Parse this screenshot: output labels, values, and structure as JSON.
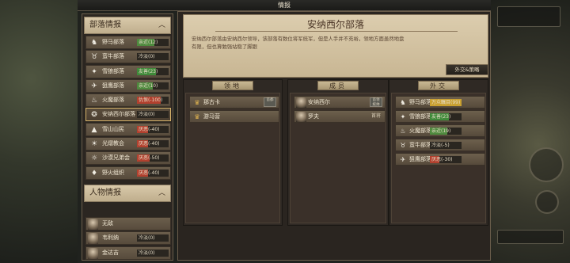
{
  "topbar": {
    "title": "情报"
  },
  "left": {
    "tribes_header": "部落情报",
    "tribes": [
      {
        "name": "野马部落",
        "relation": "亲近(12)",
        "color": "#4e8a3e",
        "fill": 0.55,
        "icon": "horse-icon",
        "glyph": "♞"
      },
      {
        "name": "蛮牛部落",
        "relation": "冷淡(0)",
        "color": "#2a2620",
        "fill": 0,
        "icon": "bull-icon",
        "glyph": "♉"
      },
      {
        "name": "雪狼部落",
        "relation": "友善(23)",
        "color": "#3f8a3a",
        "fill": 0.6,
        "icon": "wolf-icon",
        "glyph": "✦"
      },
      {
        "name": "狙鹰部落",
        "relation": "亲近(10)",
        "color": "#4e8a3e",
        "fill": 0.5,
        "icon": "eagle-icon",
        "glyph": "✈"
      },
      {
        "name": "火魔部落",
        "relation": "仇恨(-100)",
        "color": "#b2402e",
        "fill": 0.75,
        "icon": "fire-demon-icon",
        "glyph": "♨"
      },
      {
        "name": "安纳西尔部落",
        "relation": "冷淡(0)",
        "color": "#2a2620",
        "fill": 0,
        "icon": "flame-crest-icon",
        "glyph": "❂"
      },
      {
        "name": "雪山山民",
        "relation": "厌恶(-40)",
        "color": "#b2402e",
        "fill": 0.35,
        "icon": "mountain-icon",
        "glyph": "▲"
      },
      {
        "name": "光熠教会",
        "relation": "厌恶(-40)",
        "color": "#b2402e",
        "fill": 0.35,
        "icon": "sun-icon",
        "glyph": "☀"
      },
      {
        "name": "沙漠兄弟会",
        "relation": "厌恶(-50)",
        "color": "#b2402e",
        "fill": 0.4,
        "icon": "desert-icon",
        "glyph": "☼"
      },
      {
        "name": "野火组织",
        "relation": "厌恶(-40)",
        "color": "#b2402e",
        "fill": 0.35,
        "icon": "wildfire-icon",
        "glyph": "♦"
      }
    ],
    "chars_header": "人物情报",
    "chars": [
      {
        "name": "无敌",
        "relation": ""
      },
      {
        "name": "韦利纳",
        "relation": "冷淡(0)"
      },
      {
        "name": "金达吉",
        "relation": "冷淡(0)"
      }
    ]
  },
  "main": {
    "title": "安纳西尔部落",
    "description": "安纳西尔部落由安纳西尔领导，该部落有数位将军统军，但是人手并不充裕，领地方面虽然地盘有限，但也算勉强站稳了脚跟",
    "diplomacy_button": "外交&策略",
    "territory": {
      "header": "领地",
      "items": [
        {
          "name": "那古卡",
          "tag": "首都"
        },
        {
          "name": "游马营",
          "tag": ""
        }
      ]
    },
    "members": {
      "header": "成员",
      "items": [
        {
          "name": "安纳西尔",
          "tag": "首领 统帅"
        },
        {
          "name": "罗夫",
          "badge": "首将"
        }
      ]
    },
    "diplomacy": {
      "header": "外交",
      "items": [
        {
          "name": "野马部落",
          "relation": "万众瞩目(99)",
          "color": "#c9a030",
          "fill": 1.0,
          "icon": "horse-icon",
          "glyph": "♞"
        },
        {
          "name": "雪狼部落",
          "relation": "友善(23)",
          "color": "#3f8a3a",
          "fill": 0.6,
          "icon": "wolf-icon",
          "glyph": "✦"
        },
        {
          "name": "火魔部落",
          "relation": "亲近(19)",
          "color": "#4e8a3e",
          "fill": 0.55,
          "icon": "fire-demon-icon",
          "glyph": "♨"
        },
        {
          "name": "蛮牛部落",
          "relation": "冷淡(-5)",
          "color": "#2a2620",
          "fill": 0,
          "icon": "bull-icon",
          "glyph": "♉"
        },
        {
          "name": "狙鹰部落",
          "relation": "厌恶(-30)",
          "color": "#b2402e",
          "fill": 0.3,
          "icon": "eagle-icon",
          "glyph": "✈"
        }
      ]
    }
  }
}
